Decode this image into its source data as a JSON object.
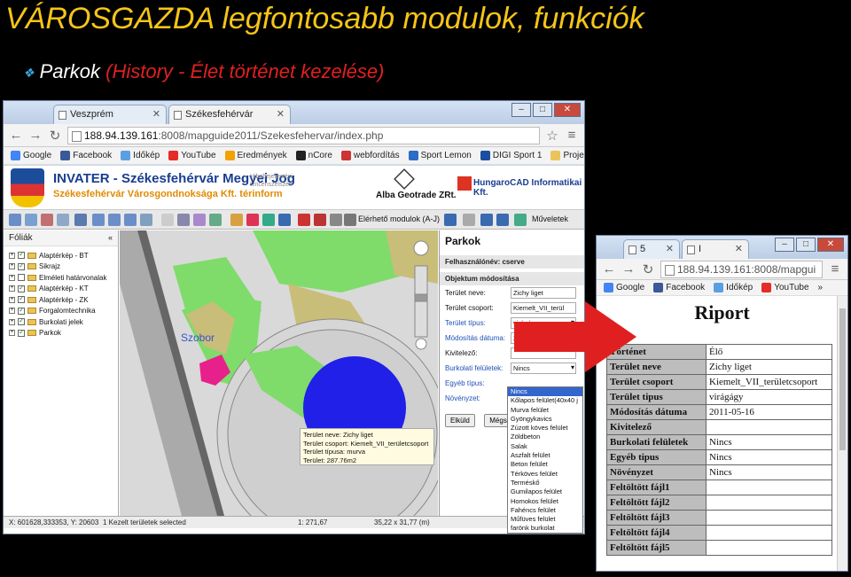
{
  "slide": {
    "title": "VÁROSGAZDA legfontosabb modulok, funkciók",
    "bullet_main": "Parkok ",
    "bullet_paren": "(History - Élet történet kezelése)"
  },
  "browser_main": {
    "tabs": [
      {
        "label": "Veszprém",
        "active": false
      },
      {
        "label": "Székesfehérvár",
        "active": true
      }
    ],
    "url_host": "188.94.139.161",
    "url_rest": ":8008/mapguide2011/Szekesfehervar/index.php",
    "bookmarks": [
      "Google",
      "Facebook",
      "Időkép",
      "YouTube",
      "Eredmények",
      "nCore",
      "webfordítás",
      "Sport Lemon",
      "DIGI Sport 1",
      "Projektek"
    ],
    "banner_title": "INVATER - Székesfehérvár Megyei Jog",
    "banner_subtitle": "Székesfehérvár Városgondnoksága Kft. térinform",
    "banner_small": "Hibabejelentési Lincenszelszés",
    "alba": "Alba Geotrade ZRt.",
    "hungarocad": "HungaroCAD Informatikai Kft.",
    "toolbar_module": "Elérhető modulok (A-J)",
    "toolbar_actions": "Műveletek",
    "layers_header": "Fóliák",
    "layers": [
      {
        "name": "Alaptérkép - BT",
        "checked": true
      },
      {
        "name": "Sikrajz",
        "checked": true
      },
      {
        "name": "Elméleti határvonalak",
        "checked": false
      },
      {
        "name": "Alaptérkép - KT",
        "checked": true
      },
      {
        "name": "Alaptérkép - ZK",
        "checked": true
      },
      {
        "name": "Forgalomtechnika",
        "checked": true
      },
      {
        "name": "Burkolati jelek",
        "checked": true
      },
      {
        "name": "Parkok",
        "checked": true
      }
    ],
    "map_label": "Szobor",
    "tooltip": [
      "Terület neve: Zichy liget",
      "Terület csoport: Kiemelt_VII_területcsoport",
      "Terület típusa: murva",
      "Terület: 287.76m2"
    ],
    "panel": {
      "title": "Parkok",
      "user": "Felhasználónév: cserve",
      "section": "Objektum módosítása",
      "fields": [
        {
          "label": "Terület neve:",
          "value": "Zichy liget",
          "blue": false,
          "dropdown": false
        },
        {
          "label": "Terület csoport:",
          "value": "Kiemelt_VII_terül",
          "blue": false,
          "dropdown": false
        },
        {
          "label": "Terület típus:",
          "value": "virágágy",
          "blue": true,
          "dropdown": true
        },
        {
          "label": "Módosítás dátuma:",
          "value": "2011-05-16",
          "blue": true,
          "dropdown": false
        },
        {
          "label": "Kivitelező:",
          "value": "",
          "blue": false,
          "dropdown": false
        },
        {
          "label": "Burkolati felületek:",
          "value": "Nincs",
          "blue": true,
          "dropdown": true
        },
        {
          "label": "Egyéb típus:",
          "value": "",
          "blue": true,
          "dropdown": false
        },
        {
          "label": "Növényzet:",
          "value": "",
          "blue": true,
          "dropdown": false
        }
      ],
      "send_button": "Elküld",
      "cancel_button": "Mégse"
    },
    "dropdown_options": [
      "Nincs",
      "Kőlapos felület(40x40 j",
      "Murva felület",
      "Gyöngykavics",
      "Zúzott köves felület",
      "Zöldbeton",
      "Salak",
      "Aszfalt felület",
      "Beton felület",
      "Térköves felület",
      "Terméskő",
      "Gumilapos felület",
      "Homokos felület",
      "Fahéncs felület",
      "Műfüves felület",
      "farönk burkolat"
    ],
    "status": {
      "coords": "X: 601628,333353, Y: 20603",
      "selected": "1 Kezelt területek selected",
      "scale": "1: 271,67",
      "size": "35,22 x 31,77 (m)"
    }
  },
  "browser_report": {
    "tabs": [
      "5",
      "I"
    ],
    "url": "188.94.139.161:8008/mapgui",
    "bookmarks": [
      "Google",
      "Facebook",
      "Időkép",
      "YouTube"
    ],
    "title": "Riport",
    "rows": [
      {
        "key": "Történet",
        "value": "Élő"
      },
      {
        "key": "Terület neve",
        "value": "Zichy liget"
      },
      {
        "key": "Terület csoport",
        "value": "Kiemelt_VII_területcsoport"
      },
      {
        "key": "Terület tipus",
        "value": "virágágy"
      },
      {
        "key": "Módosítás dátuma",
        "value": "2011-05-16"
      },
      {
        "key": "Kivitelező",
        "value": ""
      },
      {
        "key": "Burkolati felületek",
        "value": "Nincs"
      },
      {
        "key": "Egyéb tipus",
        "value": "Nincs"
      },
      {
        "key": "Növényzet",
        "value": "Nincs"
      },
      {
        "key": "Feltöltött fájl1",
        "value": ""
      },
      {
        "key": "Feltöltött fájl2",
        "value": ""
      },
      {
        "key": "Feltöltött fájl3",
        "value": ""
      },
      {
        "key": "Feltöltött fájl4",
        "value": ""
      },
      {
        "key": "Feltöltött fájl5",
        "value": ""
      }
    ]
  },
  "colors": {
    "title": "#f5c518",
    "accent_red": "#e02020",
    "map_green": "#7fdc6a",
    "map_blue_circle": "#2020e8",
    "highlight_pink": "#e8208c"
  }
}
